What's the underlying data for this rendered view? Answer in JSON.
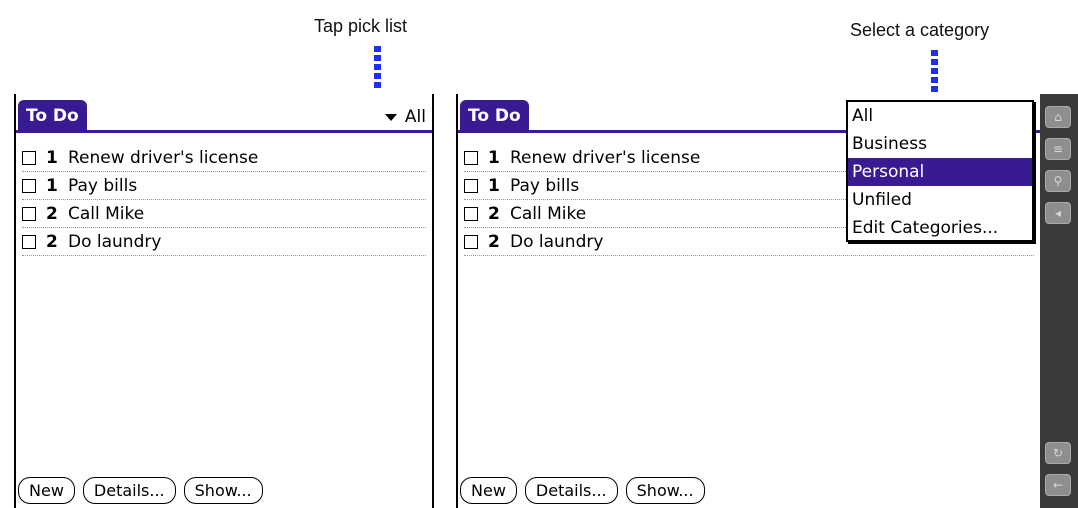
{
  "callouts": {
    "left": "Tap pick list",
    "right": "Select a category"
  },
  "app": {
    "title": "To Do",
    "category": "All"
  },
  "todos": [
    {
      "priority": "1",
      "text": "Renew driver's license"
    },
    {
      "priority": "1",
      "text": "Pay bills"
    },
    {
      "priority": "2",
      "text": "Call Mike"
    },
    {
      "priority": "2",
      "text": "Do laundry"
    }
  ],
  "buttons": {
    "new": "New",
    "details": "Details...",
    "show": "Show..."
  },
  "category_menu": {
    "options": [
      "All",
      "Business",
      "Personal",
      "Unfiled",
      "Edit Categories..."
    ],
    "selected": "Personal"
  },
  "colors": {
    "accent": "#3a1a92",
    "callout_line": "#1f2ef0",
    "sidebar": "#3a3a3a"
  },
  "sidebar_icons": [
    "home-icon",
    "menu-icon",
    "find-icon",
    "speaker-icon",
    "rotate-icon",
    "back-arrow-icon"
  ]
}
